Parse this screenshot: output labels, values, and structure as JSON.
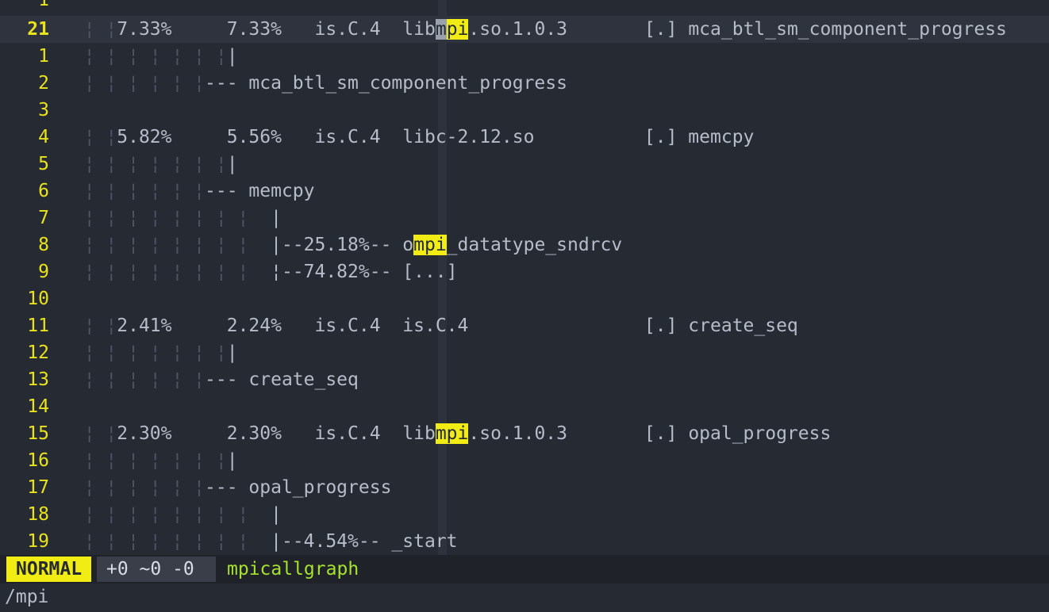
{
  "editor": {
    "top_partial_line": "1",
    "current_line_number": "21",
    "lines": [
      {
        "n": "21",
        "pre": "  ¦ ¦",
        "text": "7.33%     7.33%   is.C.4  lib",
        "hl_cursor": "m",
        "hl": "pi",
        "post": ".so.1.0.3       [.] mca_btl_sm_component_progress"
      },
      {
        "n": "1",
        "pre": "  ¦ ¦ ¦ ¦ ¦ ¦ ¦",
        "text": "|"
      },
      {
        "n": "2",
        "pre": "  ¦ ¦ ¦ ¦ ¦ ¦",
        "text": "--- mca_btl_sm_component_progress"
      },
      {
        "n": "3",
        "pre": "",
        "text": ""
      },
      {
        "n": "4",
        "pre": "  ¦ ¦",
        "text": "5.82%     5.56%   is.C.4  libc-2.12.so          [.] memcpy"
      },
      {
        "n": "5",
        "pre": "  ¦ ¦ ¦ ¦ ¦ ¦ ¦",
        "text": "|"
      },
      {
        "n": "6",
        "pre": "  ¦ ¦ ¦ ¦ ¦ ¦",
        "text": "--- memcpy"
      },
      {
        "n": "7",
        "pre": "  ¦ ¦ ¦ ¦ ¦ ¦ ¦ ¦",
        "text": "  |"
      },
      {
        "n": "8",
        "pre": "  ¦ ¦ ¦ ¦ ¦ ¦ ¦ ¦",
        "text": "  |--25.18%-- o",
        "hl": "mpi",
        "post": "_datatype_sndrcv"
      },
      {
        "n": "9",
        "pre": "  ¦ ¦ ¦ ¦ ¦ ¦ ¦ ¦",
        "text": "  ¦--74.82%-- [...]"
      },
      {
        "n": "10",
        "pre": "",
        "text": ""
      },
      {
        "n": "11",
        "pre": "  ¦ ¦",
        "text": "2.41%     2.24%   is.C.4  is.C.4                [.] create_seq"
      },
      {
        "n": "12",
        "pre": "  ¦ ¦ ¦ ¦ ¦ ¦ ¦",
        "text": "|"
      },
      {
        "n": "13",
        "pre": "  ¦ ¦ ¦ ¦ ¦ ¦",
        "text": "--- create_seq"
      },
      {
        "n": "14",
        "pre": "",
        "text": ""
      },
      {
        "n": "15",
        "pre": "  ¦ ¦",
        "text": "2.30%     2.30%   is.C.4  lib",
        "hl": "mpi",
        "post": ".so.1.0.3       [.] opal_progress"
      },
      {
        "n": "16",
        "pre": "  ¦ ¦ ¦ ¦ ¦ ¦ ¦",
        "text": "|"
      },
      {
        "n": "17",
        "pre": "  ¦ ¦ ¦ ¦ ¦ ¦",
        "text": "--- opal_progress"
      },
      {
        "n": "18",
        "pre": "  ¦ ¦ ¦ ¦ ¦ ¦ ¦ ¦",
        "text": "  |"
      },
      {
        "n": "19",
        "pre": "  ¦ ¦ ¦ ¦ ¦ ¦ ¦ ¦",
        "text": "  |--4.54%-- _start"
      }
    ]
  },
  "statusbar": {
    "mode": "NORMAL",
    "diff": "+0 ~0 -0",
    "filename": "mpicallgraph"
  },
  "cmdline": {
    "text": "/mpi"
  },
  "colors": {
    "background": "#262a33",
    "line_number": "#e8e31c",
    "search_highlight": "#f0ec14",
    "filename": "#a6e22e"
  }
}
